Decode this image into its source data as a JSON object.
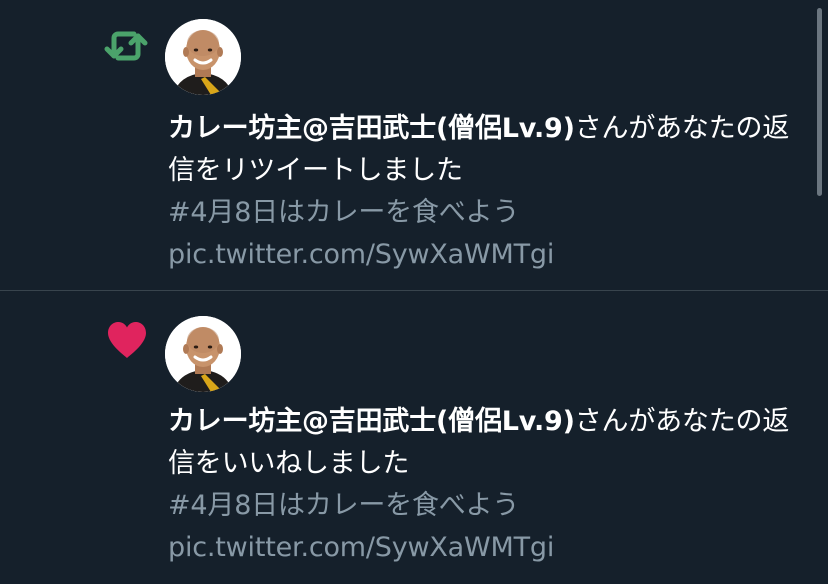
{
  "colors": {
    "background": "#15202b",
    "divider": "#38444d",
    "retweet_green": "#4ba36b",
    "like_red": "#e0245e",
    "secondary_text": "#8899a6",
    "primary_text": "#ffffff"
  },
  "notifications": [
    {
      "type_icon": "retweet-icon",
      "user_name": "カレー坊主@吉田武士(僧侶Lv.9)",
      "action_text": "さんがあなたの返信をリツイートしました",
      "tweet_text": "#4月8日はカレーを食べよう pic.twitter.com/SywXaWMTgi"
    },
    {
      "type_icon": "heart-icon",
      "user_name": "カレー坊主@吉田武士(僧侶Lv.9)",
      "action_text": "さんがあなたの返信をいいねしました",
      "tweet_text": "#4月8日はカレーを食べよう pic.twitter.com/SywXaWMTgi"
    }
  ]
}
